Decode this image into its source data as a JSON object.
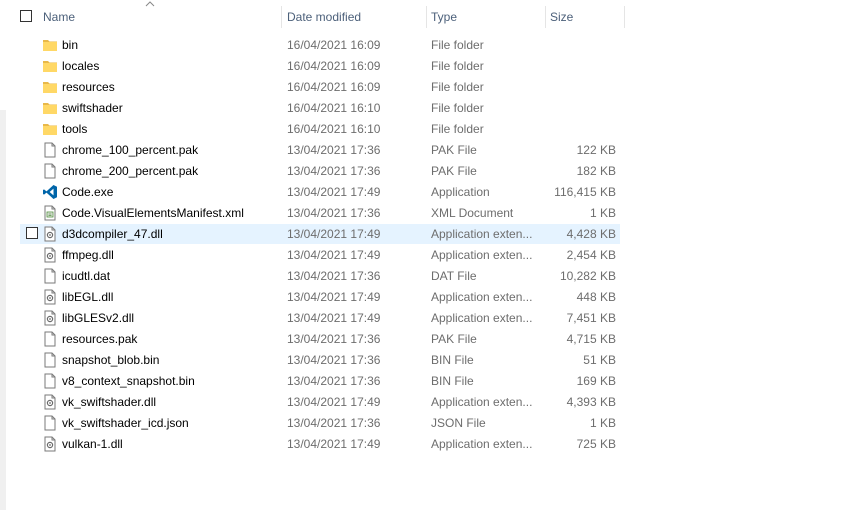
{
  "header": {
    "name": "Name",
    "date_modified": "Date modified",
    "type": "Type",
    "size": "Size"
  },
  "files": [
    {
      "name": "bin",
      "date": "16/04/2021 16:09",
      "type": "File folder",
      "size": "",
      "icon": "folder-icon"
    },
    {
      "name": "locales",
      "date": "16/04/2021 16:09",
      "type": "File folder",
      "size": "",
      "icon": "folder-icon"
    },
    {
      "name": "resources",
      "date": "16/04/2021 16:09",
      "type": "File folder",
      "size": "",
      "icon": "folder-icon"
    },
    {
      "name": "swiftshader",
      "date": "16/04/2021 16:10",
      "type": "File folder",
      "size": "",
      "icon": "folder-icon"
    },
    {
      "name": "tools",
      "date": "16/04/2021 16:10",
      "type": "File folder",
      "size": "",
      "icon": "folder-icon"
    },
    {
      "name": "chrome_100_percent.pak",
      "date": "13/04/2021 17:36",
      "type": "PAK File",
      "size": "122 KB",
      "icon": "file-icon"
    },
    {
      "name": "chrome_200_percent.pak",
      "date": "13/04/2021 17:36",
      "type": "PAK File",
      "size": "182 KB",
      "icon": "file-icon"
    },
    {
      "name": "Code.exe",
      "date": "13/04/2021 17:49",
      "type": "Application",
      "size": "116,415 KB",
      "icon": "vscode-icon"
    },
    {
      "name": "Code.VisualElementsManifest.xml",
      "date": "13/04/2021 17:36",
      "type": "XML Document",
      "size": "1 KB",
      "icon": "xml-file-icon"
    },
    {
      "name": "d3dcompiler_47.dll",
      "date": "13/04/2021 17:49",
      "type": "Application exten...",
      "size": "4,428 KB",
      "icon": "dll-file-icon",
      "hover": true
    },
    {
      "name": "ffmpeg.dll",
      "date": "13/04/2021 17:49",
      "type": "Application exten...",
      "size": "2,454 KB",
      "icon": "dll-file-icon"
    },
    {
      "name": "icudtl.dat",
      "date": "13/04/2021 17:36",
      "type": "DAT File",
      "size": "10,282 KB",
      "icon": "file-icon"
    },
    {
      "name": "libEGL.dll",
      "date": "13/04/2021 17:49",
      "type": "Application exten...",
      "size": "448 KB",
      "icon": "dll-file-icon"
    },
    {
      "name": "libGLESv2.dll",
      "date": "13/04/2021 17:49",
      "type": "Application exten...",
      "size": "7,451 KB",
      "icon": "dll-file-icon"
    },
    {
      "name": "resources.pak",
      "date": "13/04/2021 17:36",
      "type": "PAK File",
      "size": "4,715 KB",
      "icon": "file-icon"
    },
    {
      "name": "snapshot_blob.bin",
      "date": "13/04/2021 17:36",
      "type": "BIN File",
      "size": "51 KB",
      "icon": "file-icon"
    },
    {
      "name": "v8_context_snapshot.bin",
      "date": "13/04/2021 17:36",
      "type": "BIN File",
      "size": "169 KB",
      "icon": "file-icon"
    },
    {
      "name": "vk_swiftshader.dll",
      "date": "13/04/2021 17:49",
      "type": "Application exten...",
      "size": "4,393 KB",
      "icon": "dll-file-icon"
    },
    {
      "name": "vk_swiftshader_icd.json",
      "date": "13/04/2021 17:36",
      "type": "JSON File",
      "size": "1 KB",
      "icon": "file-icon"
    },
    {
      "name": "vulkan-1.dll",
      "date": "13/04/2021 17:49",
      "type": "Application exten...",
      "size": "725 KB",
      "icon": "dll-file-icon"
    }
  ],
  "colors": {
    "folder": "#ffd866",
    "folder_dark": "#e8b84a",
    "vscode": "#0065a9",
    "hover": "#e5f3ff",
    "header_text": "#4c607a"
  }
}
